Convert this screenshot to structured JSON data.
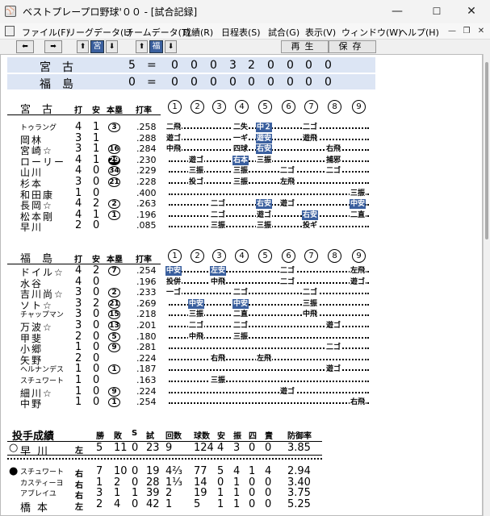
{
  "window": {
    "title": "ベストプレープロ野球'００ - [試合記録]",
    "minimize": "—",
    "maximize": "☐",
    "close": "✕"
  },
  "menu": [
    "ファイル(F)",
    "リーグデータ(L)",
    "チームデータ(T)",
    "成績(R)",
    "日程表(S)",
    "試合(G)",
    "表示(V)",
    "ウィンドウ(W)",
    "ヘルプ(H)"
  ],
  "toolbar": {
    "prev": "⬅",
    "next": "➡",
    "up1": "⬆",
    "team1": "宮",
    "down1": "⬇",
    "up2": "⬆",
    "team2": "福",
    "down2": "⬇",
    "replay": "再生",
    "save": "保存"
  },
  "scoreboard": [
    {
      "team": "宮古",
      "total": "5",
      "innings": [
        "0",
        "0",
        "0",
        "3",
        "2",
        "0",
        "0",
        "0",
        "0"
      ]
    },
    {
      "team": "福島",
      "total": "0",
      "innings": [
        "0",
        "0",
        "0",
        "0",
        "0",
        "0",
        "0",
        "0",
        "0"
      ]
    }
  ],
  "headers": {
    "da": "打",
    "an": "安",
    "hr": "本塁",
    "avg": "打率",
    "innings": [
      "1",
      "2",
      "3",
      "4",
      "5",
      "6",
      "7",
      "8",
      "9"
    ]
  },
  "team1": {
    "name": "宮古",
    "batters": [
      {
        "name": "トゥラング",
        "ab": "4",
        "h": "1",
        "hr": "3",
        "avg": ".258"
      },
      {
        "name": "岡林",
        "ab": "3",
        "h": "1",
        "hr": "",
        "avg": ".288"
      },
      {
        "name": "宮崎☆",
        "ab": "3",
        "h": "1",
        "hr": "16",
        "avg": ".284"
      },
      {
        "name": "ローリー",
        "ab": "4",
        "h": "1",
        "hr": "29",
        "avg": ".230"
      },
      {
        "name": "山川",
        "ab": "4",
        "h": "0",
        "hr": "34",
        "avg": ".229"
      },
      {
        "name": "杉本",
        "ab": "3",
        "h": "0",
        "hr": "21",
        "avg": ".228"
      },
      {
        "name": "和田康",
        "ab": "1",
        "h": "0",
        "hr": "",
        "avg": ".400"
      },
      {
        "name": "長岡☆",
        "ab": "4",
        "h": "2",
        "hr": "2",
        "avg": ".263"
      },
      {
        "name": "松本剛",
        "ab": "4",
        "h": "1",
        "hr": "1",
        "avg": ".196"
      },
      {
        "name": "早川",
        "ab": "2",
        "h": "0",
        "hr": "",
        "avg": ".085"
      }
    ]
  },
  "team2": {
    "name": "福島",
    "batters": [
      {
        "name": "ドイル☆",
        "ab": "4",
        "h": "2",
        "hr": "7",
        "avg": ".254"
      },
      {
        "name": "水谷",
        "ab": "4",
        "h": "0",
        "hr": "",
        "avg": ".196"
      },
      {
        "name": "吉川尚☆",
        "ab": "3",
        "h": "0",
        "hr": "2",
        "avg": ".233"
      },
      {
        "name": "ソト☆",
        "ab": "3",
        "h": "2",
        "hr": "21",
        "avg": ".269"
      },
      {
        "name": "チャップマン",
        "ab": "3",
        "h": "0",
        "hr": "15",
        "avg": ".218"
      },
      {
        "name": "万波☆",
        "ab": "3",
        "h": "0",
        "hr": "13",
        "avg": ".201"
      },
      {
        "name": "甲斐",
        "ab": "2",
        "h": "0",
        "hr": "5",
        "avg": ".180"
      },
      {
        "name": "小郷",
        "ab": "1",
        "h": "0",
        "hr": "9",
        "avg": ".281"
      },
      {
        "name": "矢野",
        "ab": "2",
        "h": "0",
        "hr": "",
        "avg": ".224"
      },
      {
        "name": "ヘルナンデス",
        "ab": "1",
        "h": "0",
        "hr": "1",
        "avg": ".187"
      },
      {
        "name": "スチュワート",
        "ab": "1",
        "h": "0",
        "hr": "",
        "avg": ".163"
      },
      {
        "name": "細川☆",
        "ab": "1",
        "h": "0",
        "hr": "9",
        "avg": ".224"
      },
      {
        "name": "中野",
        "ab": "1",
        "h": "0",
        "hr": "1",
        "avg": ".254"
      }
    ]
  },
  "pitching": {
    "title": "投手成績",
    "headers": [
      "勝",
      "敗",
      "S",
      "試",
      "回数",
      "球数",
      "安",
      "振",
      "四",
      "責",
      "防御率"
    ],
    "rows": [
      {
        "mark": "○",
        "name": "早川",
        "hand": "左",
        "w": "5",
        "l": "11",
        "s": "0",
        "g": "23",
        "ip": "9",
        "pitches": "124",
        "h": "4",
        "so": "3",
        "bb": "0",
        "er": "0",
        "era": "3.85"
      },
      {
        "mark": "●",
        "name": "スチュワート",
        "hand": "右",
        "w": "7",
        "l": "10",
        "s": "0",
        "g": "19",
        "ip": "4⅔",
        "pitches": "77",
        "h": "5",
        "so": "4",
        "bb": "1",
        "er": "4",
        "era": "2.94"
      },
      {
        "mark": "",
        "name": "カスティーヨ",
        "hand": "右",
        "w": "1",
        "l": "2",
        "s": "0",
        "g": "28",
        "ip": "1⅓",
        "pitches": "14",
        "h": "0",
        "so": "1",
        "bb": "0",
        "er": "0",
        "era": "3.40"
      },
      {
        "mark": "",
        "name": "アブレイユ",
        "hand": "右",
        "w": "3",
        "l": "1",
        "s": "1",
        "g": "39",
        "ip": "2",
        "pitches": "19",
        "h": "1",
        "so": "1",
        "bb": "0",
        "er": "0",
        "era": "3.75"
      },
      {
        "mark": "",
        "name": "橋本",
        "hand": "左",
        "w": "2",
        "l": "4",
        "s": "0",
        "g": "42",
        "ip": "1",
        "pitches": "5",
        "h": "1",
        "so": "1",
        "bb": "0",
        "er": "0",
        "era": "5.25"
      }
    ]
  },
  "results1": [
    [
      [
        "二飛",
        ""
      ],
      [
        "",
        ""
      ],
      [
        "",
        ""
      ],
      [
        "二失",
        ""
      ],
      [
        "中２",
        "hit"
      ],
      [
        "",
        ""
      ],
      [
        "二ゴ",
        ""
      ],
      [
        "",
        ""
      ],
      [
        "",
        ""
      ]
    ],
    [
      [
        "遊ゴ",
        ""
      ],
      [
        "",
        ""
      ],
      [
        "",
        ""
      ],
      [
        "一ギ",
        ""
      ],
      [
        "遊安",
        "hit"
      ],
      [
        "",
        ""
      ],
      [
        "遊飛",
        ""
      ],
      [
        "",
        ""
      ],
      [
        "",
        ""
      ]
    ],
    [
      [
        "中飛",
        ""
      ],
      [
        "",
        ""
      ],
      [
        "",
        ""
      ],
      [
        "四球",
        ""
      ],
      [
        "右安",
        "hit"
      ],
      [
        "",
        ""
      ],
      [
        "",
        ""
      ],
      [
        "右飛",
        ""
      ],
      [
        "",
        ""
      ]
    ],
    [
      [
        "",
        ""
      ],
      [
        "遊ゴ",
        ""
      ],
      [
        "",
        ""
      ],
      [
        "右本",
        "hit"
      ],
      [
        "三振",
        ""
      ],
      [
        "",
        ""
      ],
      [
        "",
        ""
      ],
      [
        "捕邪",
        ""
      ],
      [
        "",
        ""
      ]
    ],
    [
      [
        "",
        ""
      ],
      [
        "三振",
        ""
      ],
      [
        "",
        ""
      ],
      [
        "三振",
        ""
      ],
      [
        "",
        ""
      ],
      [
        "二ゴ",
        ""
      ],
      [
        "",
        ""
      ],
      [
        "二ゴ",
        ""
      ],
      [
        "",
        ""
      ]
    ],
    [
      [
        "",
        ""
      ],
      [
        "投ゴ",
        ""
      ],
      [
        "",
        ""
      ],
      [
        "三振",
        ""
      ],
      [
        "",
        ""
      ],
      [
        "左飛",
        ""
      ],
      [
        "",
        ""
      ],
      [
        "",
        ""
      ],
      [
        "",
        ""
      ]
    ],
    [
      [
        "",
        ""
      ],
      [
        "",
        ""
      ],
      [
        "",
        ""
      ],
      [
        "",
        ""
      ],
      [
        "",
        ""
      ],
      [
        "",
        ""
      ],
      [
        "",
        ""
      ],
      [
        "",
        ""
      ],
      [
        "三振",
        ""
      ]
    ],
    [
      [
        "",
        ""
      ],
      [
        "",
        ""
      ],
      [
        "二ゴ",
        ""
      ],
      [
        "",
        ""
      ],
      [
        "右安",
        "hit"
      ],
      [
        "遊ゴ",
        ""
      ],
      [
        "",
        ""
      ],
      [
        "",
        ""
      ],
      [
        "中安",
        "hit"
      ]
    ],
    [
      [
        "",
        ""
      ],
      [
        "",
        ""
      ],
      [
        "二ゴ",
        ""
      ],
      [
        "",
        ""
      ],
      [
        "遊ゴ",
        ""
      ],
      [
        "",
        ""
      ],
      [
        "右安",
        "hit"
      ],
      [
        "",
        ""
      ],
      [
        "二直",
        ""
      ]
    ],
    [
      [
        "",
        ""
      ],
      [
        "",
        ""
      ],
      [
        "三振",
        ""
      ],
      [
        "",
        ""
      ],
      [
        "三振",
        ""
      ],
      [
        "",
        ""
      ],
      [
        "投ギ",
        ""
      ],
      [
        "",
        ""
      ],
      [
        "",
        ""
      ]
    ]
  ],
  "results2": [
    [
      [
        "中安",
        "hit"
      ],
      [
        "",
        ""
      ],
      [
        "左安",
        "hit"
      ],
      [
        "",
        ""
      ],
      [
        "",
        ""
      ],
      [
        "二ゴ",
        ""
      ],
      [
        "",
        ""
      ],
      [
        "",
        ""
      ],
      [
        "左飛",
        ""
      ]
    ],
    [
      [
        "投併",
        ""
      ],
      [
        "",
        ""
      ],
      [
        "中飛",
        ""
      ],
      [
        "",
        ""
      ],
      [
        "",
        ""
      ],
      [
        "二ゴ",
        ""
      ],
      [
        "",
        ""
      ],
      [
        "",
        ""
      ],
      [
        "遊ゴ",
        ""
      ]
    ],
    [
      [
        "一ゴ",
        ""
      ],
      [
        "",
        ""
      ],
      [
        "",
        ""
      ],
      [
        "二ゴ",
        ""
      ],
      [
        "",
        ""
      ],
      [
        "",
        ""
      ],
      [
        "二ゴ",
        ""
      ],
      [
        "",
        ""
      ],
      [
        "",
        ""
      ]
    ],
    [
      [
        "",
        ""
      ],
      [
        "中安",
        "hit"
      ],
      [
        "",
        ""
      ],
      [
        "中安",
        "hit"
      ],
      [
        "",
        ""
      ],
      [
        "",
        ""
      ],
      [
        "三振",
        ""
      ],
      [
        "",
        ""
      ],
      [
        "",
        ""
      ]
    ],
    [
      [
        "",
        ""
      ],
      [
        "三振",
        ""
      ],
      [
        "",
        ""
      ],
      [
        "二直",
        ""
      ],
      [
        "",
        ""
      ],
      [
        "",
        ""
      ],
      [
        "中飛",
        ""
      ],
      [
        "",
        ""
      ],
      [
        "",
        ""
      ]
    ],
    [
      [
        "",
        ""
      ],
      [
        "二ゴ",
        ""
      ],
      [
        "",
        ""
      ],
      [
        "二ゴ",
        ""
      ],
      [
        "",
        ""
      ],
      [
        "",
        ""
      ],
      [
        "",
        ""
      ],
      [
        "遊ゴ",
        ""
      ],
      [
        "",
        ""
      ]
    ],
    [
      [
        "",
        ""
      ],
      [
        "中飛",
        ""
      ],
      [
        "",
        ""
      ],
      [
        "三振",
        ""
      ],
      [
        "",
        ""
      ],
      [
        "",
        ""
      ],
      [
        "",
        ""
      ],
      [
        "",
        ""
      ],
      [
        "",
        ""
      ]
    ],
    [
      [
        "",
        ""
      ],
      [
        "",
        ""
      ],
      [
        "",
        ""
      ],
      [
        "",
        ""
      ],
      [
        "",
        ""
      ],
      [
        "",
        ""
      ],
      [
        "",
        ""
      ],
      [
        "二ゴ",
        ""
      ],
      [
        "",
        ""
      ]
    ],
    [
      [
        "",
        ""
      ],
      [
        "",
        ""
      ],
      [
        "右飛",
        ""
      ],
      [
        "",
        ""
      ],
      [
        "左飛",
        ""
      ],
      [
        "",
        ""
      ],
      [
        "",
        ""
      ],
      [
        "",
        ""
      ],
      [
        "",
        ""
      ]
    ],
    [
      [
        "",
        ""
      ],
      [
        "",
        ""
      ],
      [
        "",
        ""
      ],
      [
        "",
        ""
      ],
      [
        "",
        ""
      ],
      [
        "",
        ""
      ],
      [
        "",
        ""
      ],
      [
        "遊ゴ",
        ""
      ],
      [
        "",
        ""
      ]
    ],
    [
      [
        "",
        ""
      ],
      [
        "",
        ""
      ],
      [
        "三振",
        ""
      ],
      [
        "",
        ""
      ],
      [
        "",
        ""
      ],
      [
        "",
        ""
      ],
      [
        "",
        ""
      ],
      [
        "",
        ""
      ],
      [
        "",
        ""
      ]
    ],
    [
      [
        "",
        ""
      ],
      [
        "",
        ""
      ],
      [
        "",
        ""
      ],
      [
        "",
        ""
      ],
      [
        "",
        ""
      ],
      [
        "遊ゴ",
        ""
      ],
      [
        "",
        ""
      ],
      [
        "",
        ""
      ],
      [
        "",
        ""
      ]
    ],
    [
      [
        "",
        ""
      ],
      [
        "",
        ""
      ],
      [
        "",
        ""
      ],
      [
        "",
        ""
      ],
      [
        "",
        ""
      ],
      [
        "",
        ""
      ],
      [
        "",
        ""
      ],
      [
        "",
        ""
      ],
      [
        "右飛",
        ""
      ]
    ]
  ]
}
